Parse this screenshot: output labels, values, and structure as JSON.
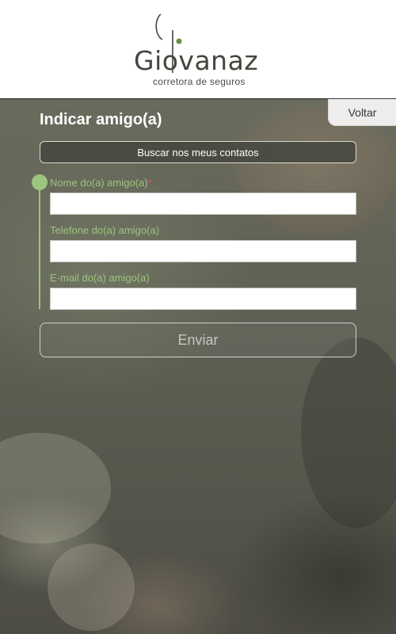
{
  "header": {
    "logo_text": "Giovanaz",
    "logo_subtitle": "corretora de seguros"
  },
  "nav": {
    "back_label": "Voltar"
  },
  "page": {
    "title": "Indicar amigo(a)"
  },
  "contacts_button": {
    "label": "Buscar nos meus contatos"
  },
  "form": {
    "fields": [
      {
        "label": "Nome do(a) amigo(a)",
        "required_marker": "*",
        "value": "",
        "placeholder": ""
      },
      {
        "label": "Telefone do(a) amigo(a)",
        "value": "",
        "placeholder": ""
      },
      {
        "label": "E-mail do(a) amigo(a)",
        "value": "",
        "placeholder": ""
      }
    ],
    "submit_label": "Enviar"
  },
  "colors": {
    "accent_green": "#9dc47f",
    "required_red": "#e2486a",
    "header_bg": "#ffffff",
    "logo_text": "#45453f"
  }
}
